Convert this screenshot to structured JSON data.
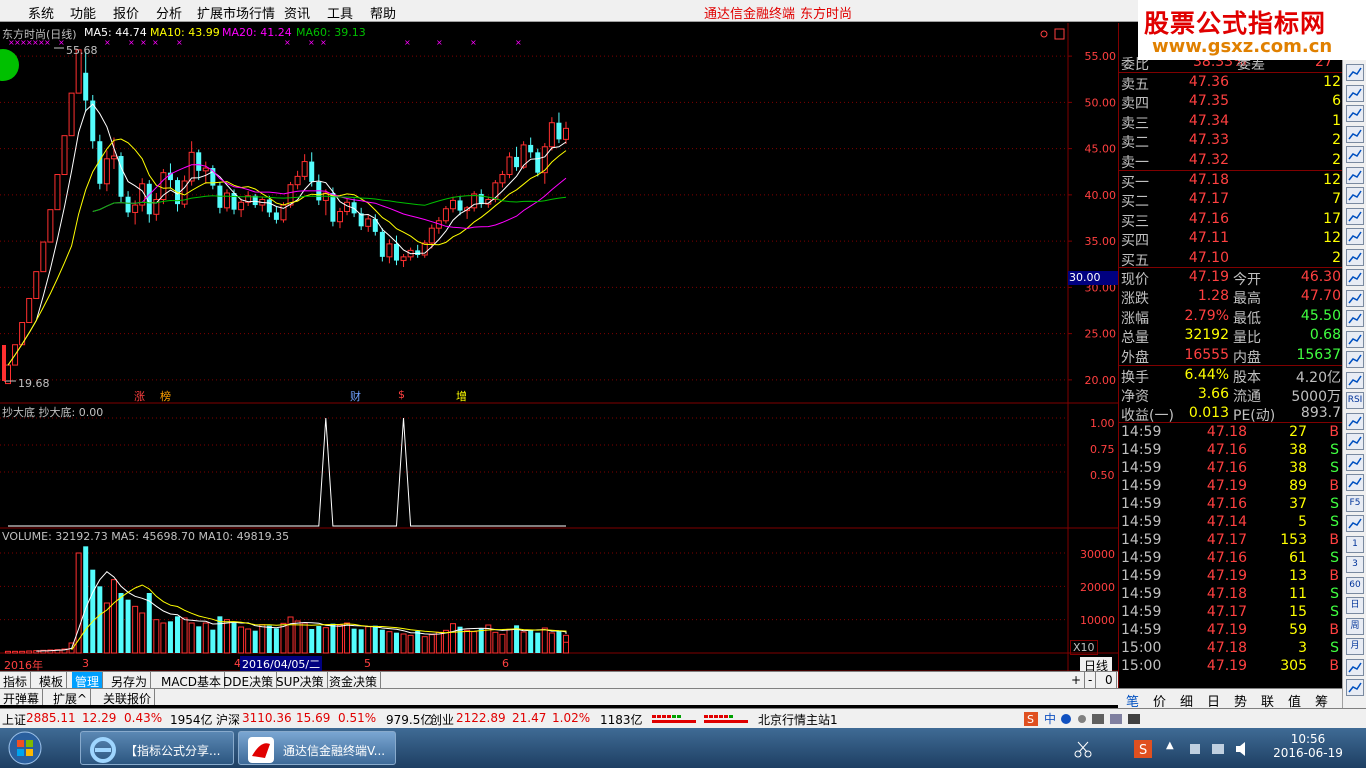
{
  "menu": {
    "items": [
      "系统",
      "功能",
      "报价",
      "分析",
      "扩展市场行情",
      "资讯",
      "工具",
      "帮助"
    ],
    "app_name": "通达信金融终端",
    "stock_name": "东方时尚"
  },
  "watermark": {
    "title": "股票公式指标网",
    "url": "www.gsxz.com.cn"
  },
  "main_chart": {
    "header_name": "东方时尚(日线)",
    "ma5": "MA5: 44.74",
    "ma10": "MA10: 43.99",
    "ma20": "MA20: 41.24",
    "ma60": "MA60: 39.13",
    "high_marker": "55.68",
    "low_marker": "19.68",
    "current_price_tag": "30.00",
    "event_tags": [
      "涨",
      "榜",
      "财",
      "$",
      "增"
    ]
  },
  "indicator": {
    "header": "抄大底  抄大底: 0.00",
    "ticks": [
      "1.00",
      "0.75",
      "0.50"
    ]
  },
  "volume": {
    "header": "VOLUME: 32192.73  MA5: 45698.70  MA10: 49819.35",
    "ticks": [
      "30000",
      "20000",
      "10000"
    ],
    "unit": "X10"
  },
  "date_axis": {
    "labels": [
      "2016年",
      "3",
      "4",
      "2016/04/05/二",
      "5",
      "6"
    ],
    "period": "日线"
  },
  "chart_data": {
    "type": "candlestick",
    "y_axis_ticks": [
      55,
      50,
      45,
      40,
      35,
      30,
      25,
      20
    ],
    "y_axis_labels": [
      "55.00",
      "50.00",
      "45.00",
      "40.00",
      "35.00",
      "30.00",
      "25.00",
      "20.00"
    ],
    "ylim": [
      17.5,
      57.5
    ],
    "high_value": 55.68,
    "low_value": 19.68,
    "candles": [
      [
        19.6,
        21.6,
        19.6,
        21.6
      ],
      [
        21.6,
        23.8,
        21.6,
        23.8
      ],
      [
        23.8,
        26.2,
        23.8,
        26.2
      ],
      [
        26.2,
        28.8,
        26.2,
        28.8
      ],
      [
        28.8,
        31.7,
        28.8,
        31.7
      ],
      [
        31.7,
        34.9,
        31.7,
        34.9
      ],
      [
        34.9,
        38.4,
        34.9,
        38.4
      ],
      [
        38.4,
        42.2,
        38.4,
        42.2
      ],
      [
        42.2,
        46.4,
        42.2,
        46.4
      ],
      [
        46.4,
        51.0,
        46.4,
        51.0
      ],
      [
        51.0,
        55.68,
        52.0,
        55.68
      ],
      [
        53.2,
        55.5,
        49.0,
        50.2
      ],
      [
        50.2,
        50.8,
        45.0,
        45.8
      ],
      [
        45.8,
        46.5,
        40.6,
        41.2
      ],
      [
        41.2,
        44.8,
        40.4,
        43.9
      ],
      [
        43.9,
        46.2,
        42.8,
        44.2
      ],
      [
        44.2,
        44.6,
        39.2,
        39.8
      ],
      [
        39.8,
        40.4,
        37.6,
        38.1
      ],
      [
        38.1,
        39.4,
        36.8,
        38.9
      ],
      [
        38.9,
        41.8,
        38.2,
        41.2
      ],
      [
        41.2,
        41.6,
        37.0,
        37.9
      ],
      [
        37.9,
        40.2,
        37.2,
        39.5
      ],
      [
        39.5,
        42.8,
        39.0,
        42.4
      ],
      [
        42.4,
        43.4,
        40.8,
        41.6
      ],
      [
        41.6,
        41.9,
        38.2,
        39.0
      ],
      [
        39.0,
        42.1,
        38.6,
        41.5
      ],
      [
        41.5,
        45.8,
        41.0,
        44.6
      ],
      [
        44.6,
        44.9,
        41.6,
        42.6
      ],
      [
        42.6,
        43.6,
        41.2,
        42.9
      ],
      [
        42.9,
        43.2,
        40.6,
        41.0
      ],
      [
        41.0,
        41.4,
        38.0,
        38.6
      ],
      [
        38.6,
        40.6,
        38.2,
        40.2
      ],
      [
        40.2,
        40.6,
        37.9,
        38.4
      ],
      [
        38.4,
        39.6,
        37.6,
        39.2
      ],
      [
        39.2,
        40.4,
        38.8,
        39.9
      ],
      [
        39.9,
        40.1,
        38.6,
        38.9
      ],
      [
        38.9,
        39.8,
        38.2,
        39.5
      ],
      [
        39.5,
        39.9,
        37.6,
        38.1
      ],
      [
        38.1,
        38.7,
        36.9,
        37.3
      ],
      [
        37.3,
        39.2,
        37.0,
        38.9
      ],
      [
        38.9,
        41.4,
        38.6,
        41.1
      ],
      [
        41.1,
        42.6,
        40.6,
        42.0
      ],
      [
        42.0,
        44.4,
        41.6,
        43.6
      ],
      [
        43.6,
        44.6,
        40.9,
        41.4
      ],
      [
        41.4,
        42.2,
        38.9,
        39.4
      ],
      [
        39.4,
        40.6,
        37.8,
        40.2
      ],
      [
        40.2,
        40.8,
        36.6,
        37.1
      ],
      [
        37.1,
        38.6,
        36.4,
        38.2
      ],
      [
        38.2,
        39.6,
        37.8,
        39.2
      ],
      [
        39.2,
        39.6,
        37.6,
        38.0
      ],
      [
        38.0,
        38.6,
        36.2,
        36.6
      ],
      [
        36.6,
        37.8,
        36.0,
        37.4
      ],
      [
        37.4,
        37.9,
        35.6,
        36.0
      ],
      [
        36.0,
        36.4,
        32.8,
        33.3
      ],
      [
        33.3,
        35.2,
        32.6,
        34.7
      ],
      [
        34.7,
        35.6,
        32.4,
        32.9
      ],
      [
        32.9,
        33.6,
        32.2,
        33.3
      ],
      [
        33.3,
        34.3,
        32.9,
        34.0
      ],
      [
        34.0,
        34.6,
        33.2,
        33.5
      ],
      [
        33.5,
        35.1,
        33.2,
        34.8
      ],
      [
        34.8,
        36.8,
        34.2,
        36.4
      ],
      [
        36.4,
        37.6,
        35.8,
        37.2
      ],
      [
        37.2,
        38.8,
        36.9,
        38.5
      ],
      [
        38.5,
        39.8,
        38.1,
        39.4
      ],
      [
        39.4,
        39.9,
        37.8,
        38.3
      ],
      [
        38.3,
        38.8,
        37.4,
        38.6
      ],
      [
        38.6,
        40.4,
        38.2,
        40.1
      ],
      [
        40.1,
        40.6,
        38.6,
        39.0
      ],
      [
        39.0,
        39.8,
        38.6,
        39.5
      ],
      [
        39.5,
        41.6,
        39.2,
        41.3
      ],
      [
        41.3,
        42.6,
        40.8,
        42.2
      ],
      [
        42.2,
        44.6,
        41.8,
        44.1
      ],
      [
        44.1,
        45.2,
        42.6,
        43.0
      ],
      [
        43.0,
        45.8,
        42.8,
        45.4
      ],
      [
        45.4,
        46.2,
        44.0,
        44.6
      ],
      [
        44.6,
        45.0,
        42.0,
        42.4
      ],
      [
        42.4,
        45.6,
        41.2,
        45.2
      ],
      [
        45.2,
        48.4,
        44.8,
        47.8
      ],
      [
        47.8,
        48.9,
        45.6,
        46.0
      ],
      [
        46.0,
        47.9,
        45.5,
        47.19
      ]
    ],
    "indicator_spikes": [
      45,
      56
    ],
    "volumes": [
      500,
      500,
      500,
      600,
      700,
      800,
      900,
      1000,
      1200,
      3000,
      30000,
      32000,
      25000,
      20000,
      15000,
      22000,
      18000,
      16000,
      14000,
      12000,
      18000,
      10000,
      9000,
      9500,
      11000,
      10500,
      9000,
      8000,
      9000,
      7000,
      11000,
      10000,
      9200,
      7800,
      7200,
      6700,
      8500,
      8200,
      7400,
      8900,
      10800,
      9600,
      9000,
      7200,
      8100,
      7600,
      8800,
      8400,
      9000,
      7300,
      7100,
      7900,
      8200,
      7000,
      6400,
      6100,
      5700,
      5300,
      6600,
      4900,
      5500,
      6200,
      6800,
      8800,
      7900,
      6800,
      6400,
      7300,
      8400,
      6200,
      5600,
      7100,
      8300,
      6300,
      6900,
      6100,
      7500,
      6000,
      6700,
      5300,
      3219
    ],
    "vol_ylim": [
      0,
      36000
    ]
  },
  "quote_panel": {
    "weibi_label": "委比",
    "weibi_value": "38.33%",
    "weicha_label": "委差",
    "weicha_value": "27",
    "sell": [
      {
        "label": "卖五",
        "price": "47.36",
        "vol": "12"
      },
      {
        "label": "卖四",
        "price": "47.35",
        "vol": "6"
      },
      {
        "label": "卖三",
        "price": "47.34",
        "vol": "1"
      },
      {
        "label": "卖二",
        "price": "47.33",
        "vol": "2"
      },
      {
        "label": "卖一",
        "price": "47.32",
        "vol": "2"
      }
    ],
    "buy": [
      {
        "label": "买一",
        "price": "47.18",
        "vol": "12"
      },
      {
        "label": "买二",
        "price": "47.17",
        "vol": "7"
      },
      {
        "label": "买三",
        "price": "47.16",
        "vol": "17"
      },
      {
        "label": "买四",
        "price": "47.11",
        "vol": "12"
      },
      {
        "label": "买五",
        "price": "47.10",
        "vol": "2"
      }
    ],
    "stats": [
      {
        "l1": "现价",
        "v1": "47.19",
        "c1": "#ff4040",
        "l2": "今开",
        "v2": "46.30",
        "c2": "#ff4040"
      },
      {
        "l1": "涨跌",
        "v1": "1.28",
        "c1": "#ff4040",
        "l2": "最高",
        "v2": "47.70",
        "c2": "#ff4040"
      },
      {
        "l1": "涨幅",
        "v1": "2.79%",
        "c1": "#ff4040",
        "l2": "最低",
        "v2": "45.50",
        "c2": "#40ff40"
      },
      {
        "l1": "总量",
        "v1": "32192",
        "c1": "#ffff00",
        "l2": "量比",
        "v2": "0.68",
        "c2": "#40ff40"
      },
      {
        "l1": "外盘",
        "v1": "16555",
        "c1": "#ff4040",
        "l2": "内盘",
        "v2": "15637",
        "c2": "#40ff40"
      }
    ],
    "stats2": [
      {
        "l1": "换手",
        "v1": "6.44%",
        "l2": "股本",
        "v2": "4.20亿"
      },
      {
        "l1": "净资",
        "v1": "3.66",
        "l2": "流通",
        "v2": "5000万"
      },
      {
        "l1": "收益(一)",
        "v1": "0.013",
        "l2": "PE(动)",
        "v2": "893.7"
      }
    ],
    "ticks": [
      {
        "t": "14:59",
        "p": "47.18",
        "v": "27",
        "s": "B"
      },
      {
        "t": "14:59",
        "p": "47.16",
        "v": "38",
        "s": "S"
      },
      {
        "t": "14:59",
        "p": "47.16",
        "v": "38",
        "s": "S"
      },
      {
        "t": "14:59",
        "p": "47.19",
        "v": "89",
        "s": "B"
      },
      {
        "t": "14:59",
        "p": "47.16",
        "v": "37",
        "s": "S"
      },
      {
        "t": "14:59",
        "p": "47.14",
        "v": "5",
        "s": "S"
      },
      {
        "t": "14:59",
        "p": "47.17",
        "v": "153",
        "s": "B"
      },
      {
        "t": "14:59",
        "p": "47.16",
        "v": "61",
        "s": "S"
      },
      {
        "t": "14:59",
        "p": "47.19",
        "v": "13",
        "s": "B"
      },
      {
        "t": "14:59",
        "p": "47.18",
        "v": "11",
        "s": "S"
      },
      {
        "t": "14:59",
        "p": "47.17",
        "v": "15",
        "s": "S"
      },
      {
        "t": "14:59",
        "p": "47.19",
        "v": "59",
        "s": "B"
      },
      {
        "t": "15:00",
        "p": "47.18",
        "v": "3",
        "s": "S"
      },
      {
        "t": "15:00",
        "p": "47.19",
        "v": "305",
        "s": "B"
      }
    ],
    "bottom_tabs": [
      "笔",
      "价",
      "细",
      "日",
      "势",
      "联",
      "值",
      "筹"
    ]
  },
  "bottom_tabs": {
    "row1": [
      "指标",
      "模板",
      "管理",
      "另存为",
      "MACD基本",
      "DDE决策",
      "SUP决策",
      "资金决策"
    ],
    "row1_active": "管理",
    "row2": [
      "开弹幕",
      "扩展^",
      "关联报价"
    ],
    "zoom_controls": [
      "+",
      "-",
      "0"
    ]
  },
  "status_bar": {
    "sh_label": "上证",
    "sh_value": "2885.11",
    "sh_chg": "12.29",
    "sh_pct": "0.43%",
    "sh_amt": "1954亿",
    "sz_label": "沪深",
    "sz_value": "3110.36",
    "sz_chg": "15.69",
    "sz_pct": "0.51%",
    "sz_amt": "979.5亿",
    "cy_label": "创业",
    "cy_value": "2122.89",
    "cy_chg": "21.47",
    "cy_pct": "1.02%",
    "cy_amt": "1183亿",
    "server": "北京行情主站1"
  },
  "right_toolbar": [
    "RSI",
    "F5",
    "1",
    "3",
    "60",
    "日",
    "周",
    "月"
  ],
  "taskbar": {
    "tasks": [
      "【指标公式分享...",
      "通达信金融终端V..."
    ],
    "time": "10:56",
    "date": "2016-06-19"
  },
  "colors": {
    "up": "#ff3030",
    "down": "#54fcfc",
    "ma5": "#ffffff",
    "ma10": "#ffff00",
    "ma20": "#ff00ff",
    "ma60": "#00c000",
    "grid": "#800000"
  }
}
